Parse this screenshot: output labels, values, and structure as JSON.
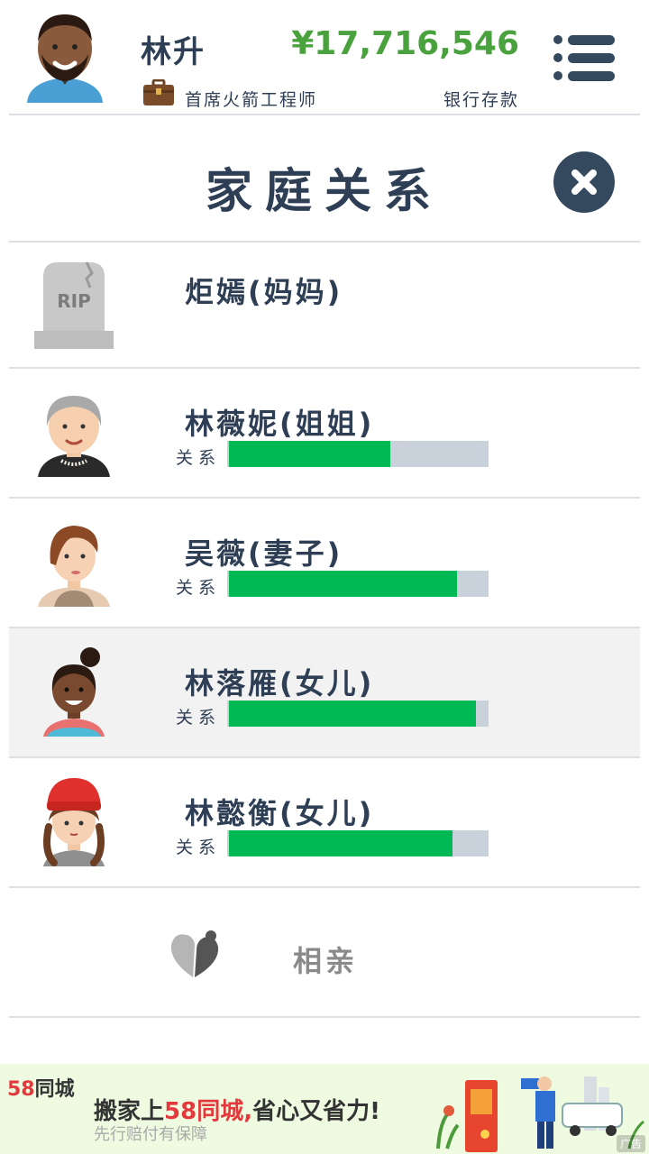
{
  "header": {
    "player_name": "林升",
    "job_title": "首席火箭工程师",
    "money": "¥17,716,546",
    "money_label": "银行存款",
    "menu_icon": "hamburger-menu-icon"
  },
  "dialog": {
    "title": "家庭关系",
    "close_icon": "close-icon"
  },
  "family": [
    {
      "name": "炬嫣(妈妈)",
      "deceased": true,
      "icon": "tombstone-rip-icon",
      "rip_text": "RIP"
    },
    {
      "name": "林薇妮(姐姐)",
      "relation_label": "关系",
      "relation": 0.62,
      "icon": "elderly-woman-portrait"
    },
    {
      "name": "吴薇(妻子)",
      "relation_label": "关系",
      "relation": 0.88,
      "icon": "woman-portrait"
    },
    {
      "name": "林落雁(女儿)",
      "relation_label": "关系",
      "relation": 0.95,
      "icon": "girl-portrait"
    },
    {
      "name": "林懿衡(女儿)",
      "relation_label": "关系",
      "relation": 0.86,
      "icon": "girl-red-hat-portrait"
    }
  ],
  "dating": {
    "label": "相亲",
    "icon": "dating-hearts-icon"
  },
  "ad": {
    "logo_number": "58",
    "logo_text": "同城",
    "headline_prefix": "搬家上",
    "headline_brand": "58同城,",
    "headline_suffix": "省心又省力!",
    "subtext": "先行赔付有保障",
    "tag": "广告"
  },
  "colors": {
    "money": "#4aa23f",
    "bar_fill": "#00b955",
    "bar_track": "#c9d1da",
    "text": "#2e3e55"
  }
}
